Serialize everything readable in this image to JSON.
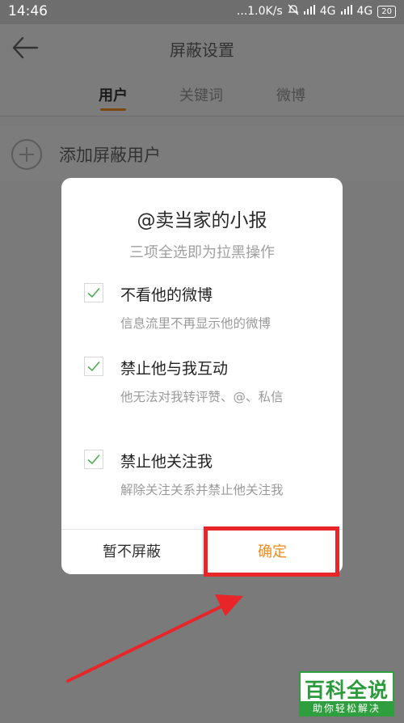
{
  "status_bar": {
    "time": "14:46",
    "network_speed": "...1.0K/s",
    "signal_1": "4G",
    "signal_2": "4G",
    "battery": "20",
    "icons": [
      "mute-icon",
      "hd-icon",
      "signal-icon",
      "battery-icon"
    ]
  },
  "nav": {
    "title": "屏蔽设置",
    "back_icon": "arrow-left-icon"
  },
  "tabs": [
    {
      "label": "用户",
      "active": true
    },
    {
      "label": "关键词",
      "active": false
    },
    {
      "label": "微博",
      "active": false
    }
  ],
  "add_row": {
    "icon": "plus-circle-icon",
    "label": "添加屏蔽用户"
  },
  "dialog": {
    "title": "@卖当家的小报",
    "subtitle": "三项全选即为拉黑操作",
    "options": [
      {
        "title": "不看他的微博",
        "desc": "信息流里不再显示他的微博",
        "checked": true
      },
      {
        "title": "禁止他与我互动",
        "desc": "他无法对我转评赞、@、私信",
        "checked": true
      },
      {
        "title": "禁止他关注我",
        "desc": "解除关注关系并禁止他关注我",
        "checked": true
      }
    ],
    "cancel_label": "暂不屏蔽",
    "confirm_label": "确定"
  },
  "colors": {
    "accent": "#f08c1a",
    "check": "#4caf50",
    "annotation": "#e8262a"
  },
  "watermark": {
    "top": "百科全说",
    "bottom": "助你轻松解决"
  }
}
